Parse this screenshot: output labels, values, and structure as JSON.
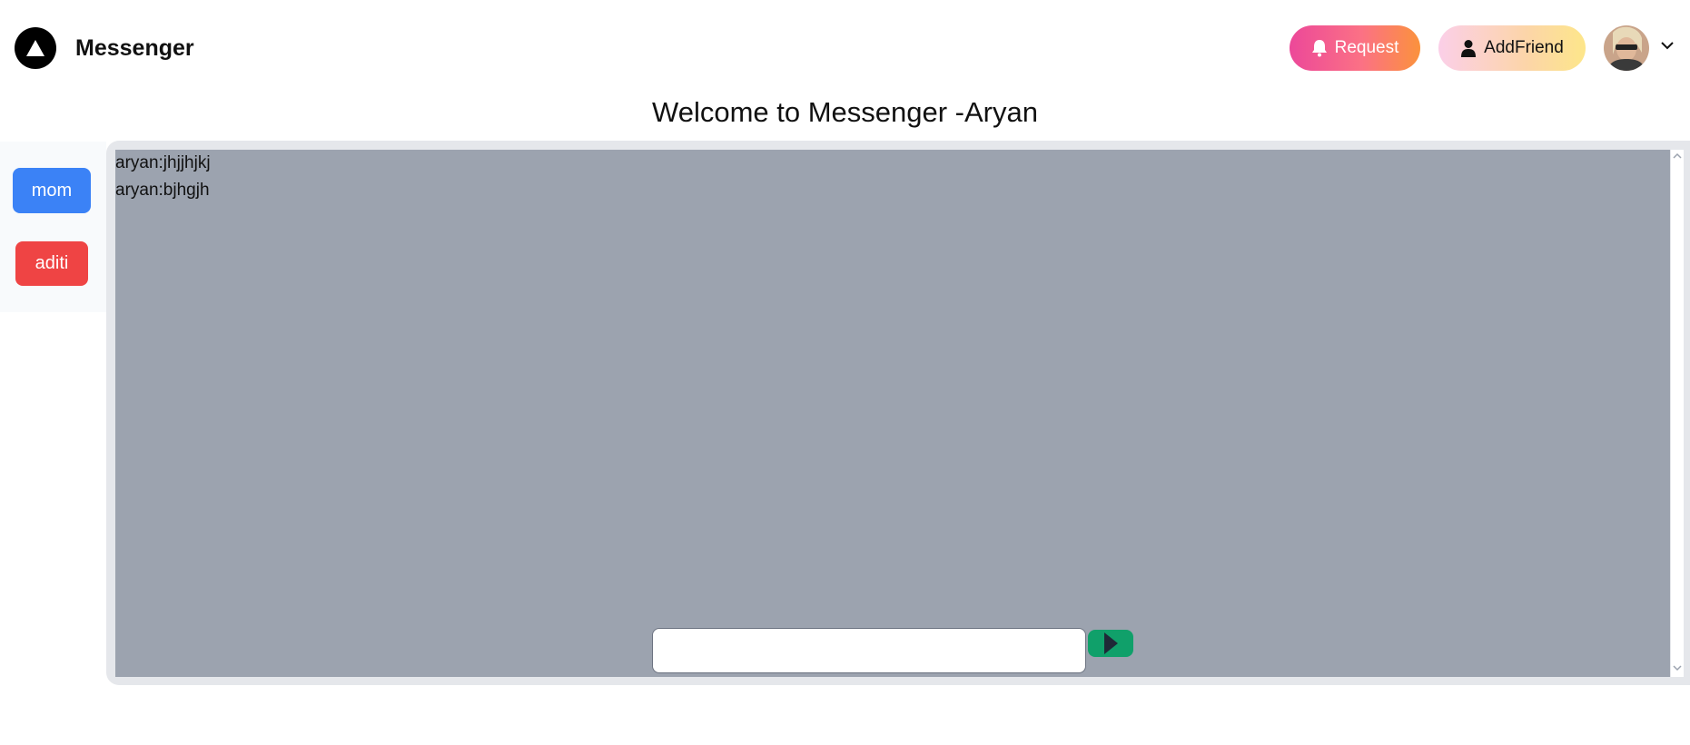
{
  "header": {
    "brand": "Messenger",
    "request_label": "Request",
    "addfriend_label": "AddFriend",
    "logo_icon": "triangle-logo-icon",
    "request_icon": "bell-icon",
    "addfriend_icon": "user-icon",
    "menu_icon": "chevron-down-icon"
  },
  "welcome": "Welcome to Messenger -Aryan",
  "sidebar": {
    "friends": [
      {
        "label": "mom",
        "color": "#3b82f6"
      },
      {
        "label": "aditi",
        "color": "#ef4444"
      }
    ]
  },
  "chat": {
    "messages": [
      "aryan:jhjjhjkj",
      "aryan:bjhgjh"
    ],
    "input_value": "",
    "send_icon": "play-icon",
    "background": "#9ca3af"
  }
}
